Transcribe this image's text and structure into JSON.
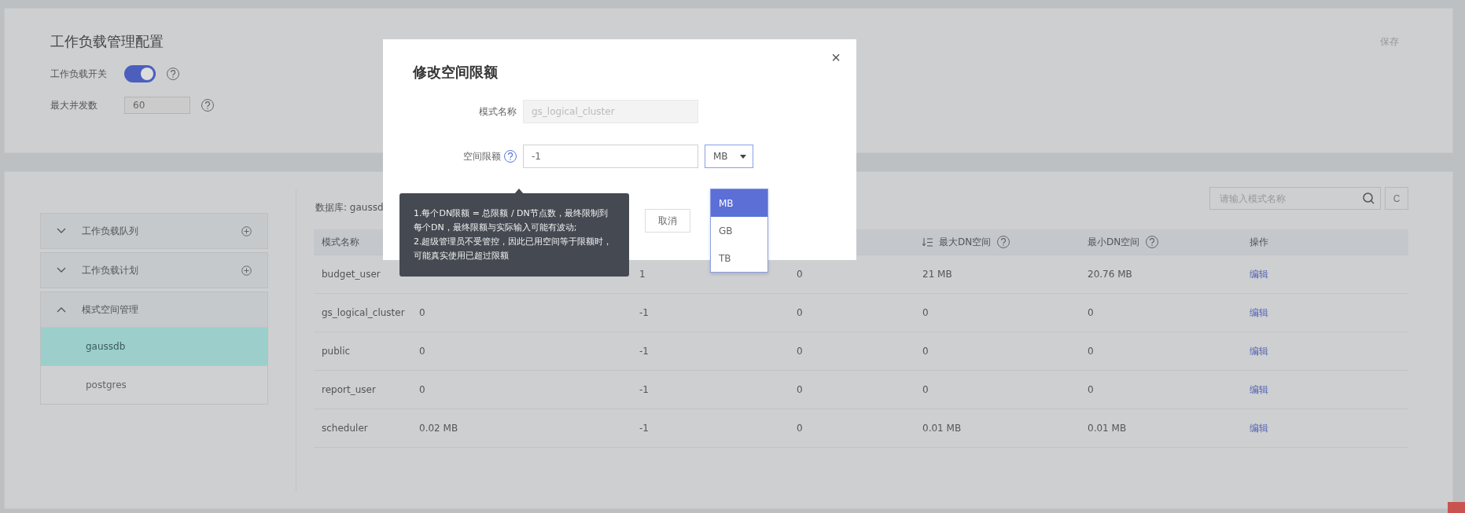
{
  "config": {
    "title": "工作负载管理配置",
    "save": "保存",
    "switch_label": "工作负载开关",
    "switch_on": true,
    "concurrency_label": "最大并发数",
    "concurrency_value": "60"
  },
  "sidebar": [
    {
      "label": "工作负载队列",
      "expanded": false
    },
    {
      "label": "工作负载计划",
      "expanded": false
    },
    {
      "label": "模式空间管理",
      "expanded": true,
      "children": [
        {
          "label": "gaussdb",
          "selected": true
        },
        {
          "label": "postgres",
          "selected": false
        }
      ]
    }
  ],
  "database_label": "数据库: gaussd",
  "search": {
    "placeholder": "请输入模式名称"
  },
  "refresh": "C",
  "columns": [
    {
      "label": "模式名称"
    },
    {
      "label": "最大DN空间",
      "help": true,
      "sortable": true
    },
    {
      "label": "最小DN空间",
      "help": true
    },
    {
      "label": "操作"
    }
  ],
  "rows": [
    {
      "name": "budget_user",
      "column_3": "1",
      "column_4": "0",
      "max_dn": "21 MB",
      "min_dn": "20.76 MB",
      "action": "编辑"
    },
    {
      "name": "gs_logical_cluster",
      "column_2": "0",
      "column_3": "-1",
      "column_4": "0",
      "max_dn": "0",
      "min_dn": "0",
      "action": "编辑"
    },
    {
      "name": "public",
      "column_2": "0",
      "column_3": "-1",
      "column_4": "0",
      "max_dn": "0",
      "min_dn": "0",
      "action": "编辑"
    },
    {
      "name": "report_user",
      "column_2": "0",
      "column_3": "-1",
      "column_4": "0",
      "max_dn": "0",
      "min_dn": "0",
      "action": "编辑"
    },
    {
      "name": "scheduler",
      "column_2": "0.02 MB",
      "column_3": "-1",
      "column_4": "0",
      "max_dn": "0.01 MB",
      "min_dn": "0.01 MB",
      "action": "编辑"
    }
  ],
  "dialog": {
    "title": "修改空间限额",
    "close": "×",
    "name_label": "模式名称",
    "name_value": "gs_logical_cluster",
    "limit_label": "空间限额",
    "limit_value": "-1",
    "unit": "MB",
    "unit_options": [
      {
        "label": "MB",
        "selected": true
      },
      {
        "label": "GB",
        "selected": false
      },
      {
        "label": "TB",
        "selected": false
      }
    ],
    "cancel": "取消"
  },
  "tooltip": [
    "1.每个DN限额 = 总限额 / DN节点数，最终限制到每个DN，最终限额与实际输入可能有波动;",
    "2.超级管理员不受管控，因此已用空间等于限额时，可能真实使用已超过限额"
  ]
}
